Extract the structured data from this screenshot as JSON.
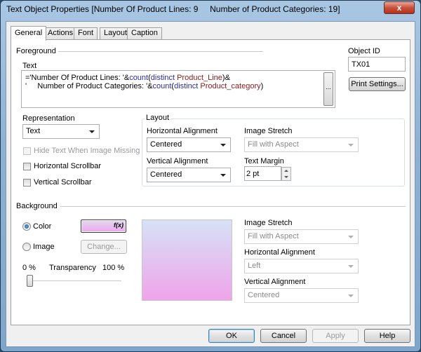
{
  "window": {
    "title": "Text Object Properties [Number Of Product Lines: 9     Number of Product Categories: 19]",
    "close_label": "x"
  },
  "tabs": [
    {
      "label": "General",
      "active": true
    },
    {
      "label": "Actions",
      "active": false
    },
    {
      "label": "Font",
      "active": false
    },
    {
      "label": "Layout",
      "active": false
    },
    {
      "label": "Caption",
      "active": false
    }
  ],
  "foreground": {
    "section_title": "Foreground",
    "text_label": "Text",
    "expression": {
      "line1": [
        {
          "t": "='Number Of Product Lines: '&",
          "c": "plain"
        },
        {
          "t": "count",
          "c": "kw"
        },
        {
          "t": "(",
          "c": "plain"
        },
        {
          "t": "distinct",
          "c": "kw"
        },
        {
          "t": " Product_Line",
          "c": "fld"
        },
        {
          "t": ")&",
          "c": "plain"
        }
      ],
      "line2": [
        {
          "t": "'     Number of Product Categories: '&",
          "c": "plain"
        },
        {
          "t": "count",
          "c": "kw"
        },
        {
          "t": "(",
          "c": "plain"
        },
        {
          "t": "distinct",
          "c": "kw"
        },
        {
          "t": " Product_category",
          "c": "fld"
        },
        {
          "t": ")",
          "c": "plain"
        }
      ]
    },
    "ellipsis_label": "...",
    "object_id_label": "Object ID",
    "object_id_value": "TX01",
    "print_settings_label": "Print Settings...",
    "representation_label": "Representation",
    "representation_value": "Text",
    "hide_text_label": "Hide Text When Image Missing",
    "hide_text_checked": false,
    "horizontal_scrollbar_label": "Horizontal Scrollbar",
    "horizontal_scrollbar_checked": false,
    "vertical_scrollbar_label": "Vertical Scrollbar",
    "vertical_scrollbar_checked": false,
    "layout": {
      "group_title": "Layout",
      "h_align_label": "Horizontal Alignment",
      "h_align_value": "Centered",
      "v_align_label": "Vertical Alignment",
      "v_align_value": "Centered",
      "image_stretch_label": "Image Stretch",
      "image_stretch_value": "Fill with Aspect",
      "text_margin_label": "Text Margin",
      "text_margin_value": "2 pt"
    }
  },
  "background": {
    "section_title": "Background",
    "color_option_label": "Color",
    "color_selected": true,
    "color_fx_label": "f(x)",
    "image_option_label": "Image",
    "change_button_label": "Change...",
    "transparency_min_label": "0 %",
    "transparency_label": "Transparency",
    "transparency_max_label": "100 %",
    "transparency_percent": 0,
    "gradient_top": "#d6e2f6",
    "gradient_bottom": "#efa4ea",
    "image_stretch_label": "Image Stretch",
    "image_stretch_value": "Fill with Aspect",
    "h_align_label": "Horizontal Alignment",
    "h_align_value": "Left",
    "v_align_label": "Vertical Alignment",
    "v_align_value": "Centered"
  },
  "buttons": {
    "ok": "OK",
    "cancel": "Cancel",
    "apply": "Apply",
    "help": "Help"
  }
}
